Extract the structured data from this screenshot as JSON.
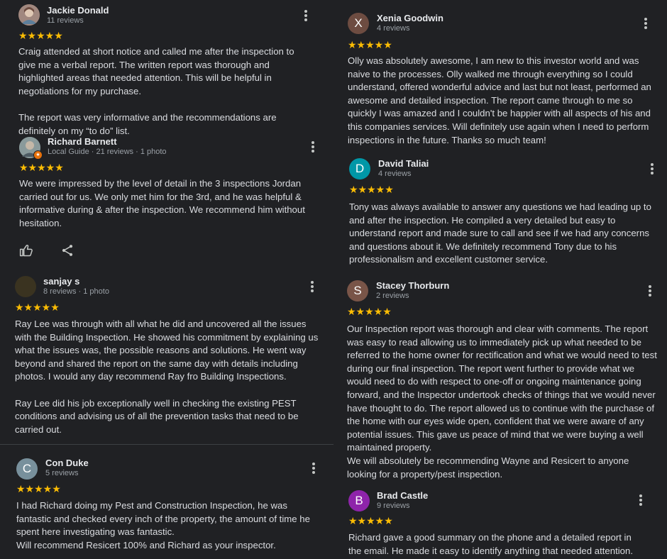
{
  "left": {
    "reviews": [
      {
        "name": "Jackie Donald",
        "meta": "11 reviews",
        "stars": "★★★★★",
        "text": "Craig attended at short notice and called me after the inspection to give me a verbal report. The written report was thorough and highlighted areas that needed attention. This will be helpful in negotiations for my purchase.\n\nThe report was very informative and the recommendations are definitely on my “to do” list.",
        "avatar_color": "#8d6e63",
        "avatar_letter": ""
      },
      {
        "name": "Richard Barnett",
        "meta": "Local Guide · 21 reviews · 1 photo",
        "stars": "★★★★★",
        "text": "We were impressed by the level of detail in the 3 inspections Jordan carried out for us. We only met him for the 3rd, and he was helpful & informative during & after the inspection. We recommend him without hesitation.",
        "avatar_color": "#7b8a8b",
        "avatar_letter": ""
      },
      {
        "name": "sanjay s",
        "meta": "8 reviews · 1 photo",
        "stars": "★★★★★",
        "text": "Ray Lee was through with all what he did and uncovered all the issues with the Building Inspection. He showed his commitment by explaining us what the issues was, the possible reasons and solutions. He went way beyond and shared the report on the same day with details including photos. I would any day recommend Ray fro Building Inspections.\n\nRay Lee did his job exceptionally well in checking the existing PEST conditions and advising us of all the prevention tasks that need to be carried out.",
        "avatar_color": "#3a3320",
        "avatar_letter": ""
      },
      {
        "name": "Con Duke",
        "meta": "5 reviews",
        "stars": "★★★★★",
        "text": "I had Richard doing my Pest and Construction Inspection, he was fantastic and checked every inch of the property, the amount of time he spent here investigating was fantastic.\nWill recommend Resicert 100% and Richard as your inspector.",
        "avatar_color": "#78909c",
        "avatar_letter": "C"
      }
    ]
  },
  "right": {
    "reviews": [
      {
        "name": "Xenia Goodwin",
        "meta": "4 reviews",
        "stars": "★★★★★",
        "text": "Olly was absolutely awesome, I am new to this investor world and was naive to the processes. Olly walked me through everything so I could understand, offered wonderful advice and last but not least, performed an awesome and detailed inspection. The report came through to me so quickly I was amazed and I couldn't be happier with all aspects of his and this companies services. Will definitely use again when I need to perform inspections in the future. Thanks so much team!",
        "avatar_color": "#6d4c41",
        "avatar_letter": "X"
      },
      {
        "name": "David Taliai",
        "meta": "4 reviews",
        "stars": "★★★★★",
        "text": "Tony was always available to answer any questions we had leading up to and after the inspection. He compiled a very detailed but easy to understand report and made sure to call and see if we had any concerns and questions about it. We definitely recommend Tony due to his professionalism and excellent customer service.",
        "avatar_color": "#0097a7",
        "avatar_letter": "D"
      },
      {
        "name": "Stacey Thorburn",
        "meta": "2 reviews",
        "stars": "★★★★★",
        "text": "Our Inspection report was thorough and clear with comments. The report was easy to read allowing us to immediately pick up what needed to be referred to the home owner for rectification and what we would need to test during our final inspection. The report went further to provide what we would need to do with respect to one-off or ongoing maintenance going forward, and the Inspector undertook checks of things that we would never have thought to do. The report allowed us to continue with the purchase of the home with our eyes wide open, confident that we were aware of any potential issues. This gave us peace of mind that we were buying a well maintained property.\nWe will absolutely be recommending Wayne and Resicert to anyone looking for a property/pest inspection.",
        "avatar_color": "#795548",
        "avatar_letter": "S"
      },
      {
        "name": "Brad Castle",
        "meta": "9 reviews",
        "stars": "★★★★★",
        "text": "Richard gave a good summary on the phone and a detailed report in the email. He made it easy to identify anything that needed attention.",
        "avatar_color": "#8e24aa",
        "avatar_letter": "B"
      }
    ]
  },
  "icons": {
    "like": "thumb-up-icon",
    "share": "share-icon",
    "more": "more-vert-icon"
  },
  "colors": {
    "background": "#202124",
    "star": "#fbbc04",
    "text": "#dadce0",
    "meta": "#9aa0a6"
  }
}
